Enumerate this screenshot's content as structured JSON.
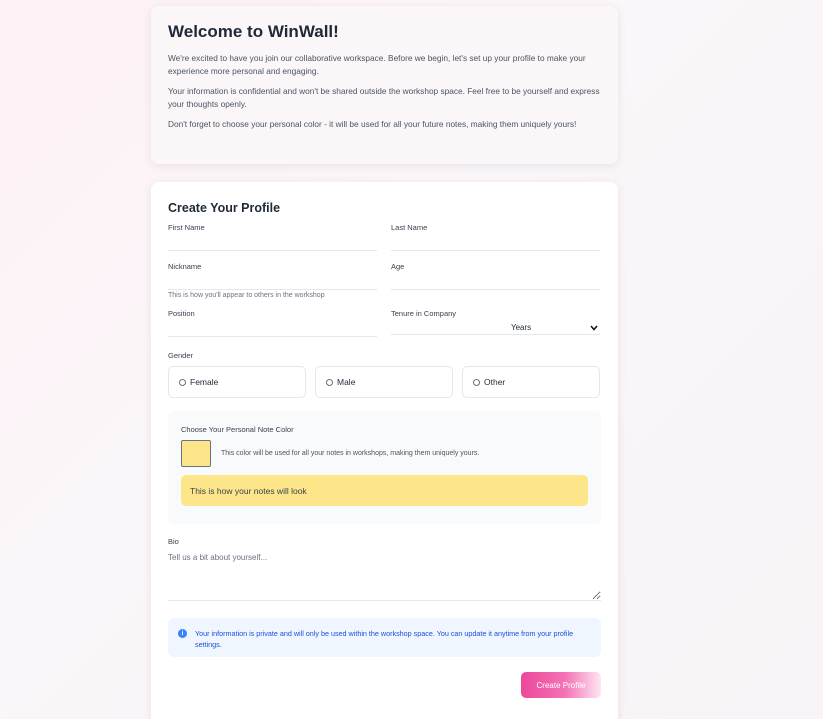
{
  "welcome": {
    "title": "Welcome to WinWall!",
    "paragraphs": [
      "We're excited to have you join our collaborative workspace. Before we begin, let's set up your profile to make your experience more personal and engaging.",
      "Your information is confidential and won't be shared outside the workshop space. Feel free to be yourself and express your thoughts openly.",
      "Don't forget to choose your personal color - it will be used for all your future notes, making them uniquely yours!"
    ]
  },
  "profile": {
    "title": "Create Your Profile",
    "first_name_label": "First Name",
    "last_name_label": "Last Name",
    "nickname_label": "Nickname",
    "nickname_hint": "This is how you'll appear to others in the workshop",
    "age_label": "Age",
    "position_label": "Position",
    "tenure_label": "Tenure in Company",
    "tenure_unit": "Years",
    "gender_label": "Gender",
    "gender_options": [
      "Female",
      "Male",
      "Other"
    ],
    "color_section": {
      "title": "Choose Your Personal Note Color",
      "hint": "This color will be used for all your notes in workshops, making them uniquely yours.",
      "selected_color": "#fde68a",
      "preview_text": "This is how your notes will look"
    },
    "bio_label": "Bio",
    "bio_placeholder": "Tell us a bit about yourself...",
    "info_text": "Your information is private and will only be used within the workshop space. You can update it anytime from your profile settings.",
    "submit_label": "Create Profile"
  },
  "colors": {
    "accent": "#ec4899",
    "info": "#3b82f6"
  }
}
